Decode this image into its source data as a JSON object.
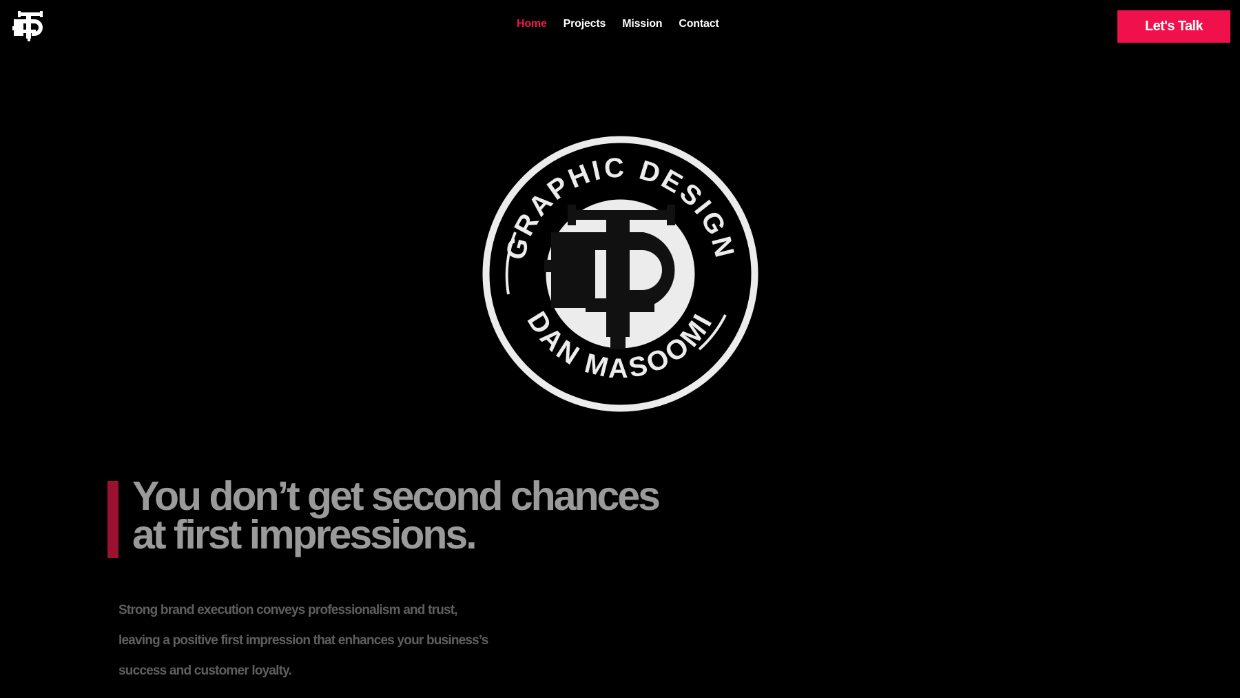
{
  "header": {
    "logo_icon": "monogram-logo-icon",
    "nav": [
      {
        "label": "Home",
        "active": true
      },
      {
        "label": "Projects",
        "active": false
      },
      {
        "label": "Mission",
        "active": false
      },
      {
        "label": "Contact",
        "active": false
      }
    ],
    "cta_label": "Let's Talk"
  },
  "badge": {
    "top_arc_text": "GRAPHIC DESIGN",
    "bottom_arc_text": "DAN MASOOMI",
    "icon": "monogram-badge-icon"
  },
  "hero": {
    "headline_lines": [
      "You don’t get second chances",
      "at first impressions."
    ],
    "subtext_lines": [
      "Strong brand execution conveys professionalism and trust,",
      "leaving a positive first impression that enhances your business’s",
      "success and customer loyalty."
    ]
  },
  "colors": {
    "accent": "#f0114c",
    "accent_dark": "#9c1130",
    "background": "#000000"
  }
}
